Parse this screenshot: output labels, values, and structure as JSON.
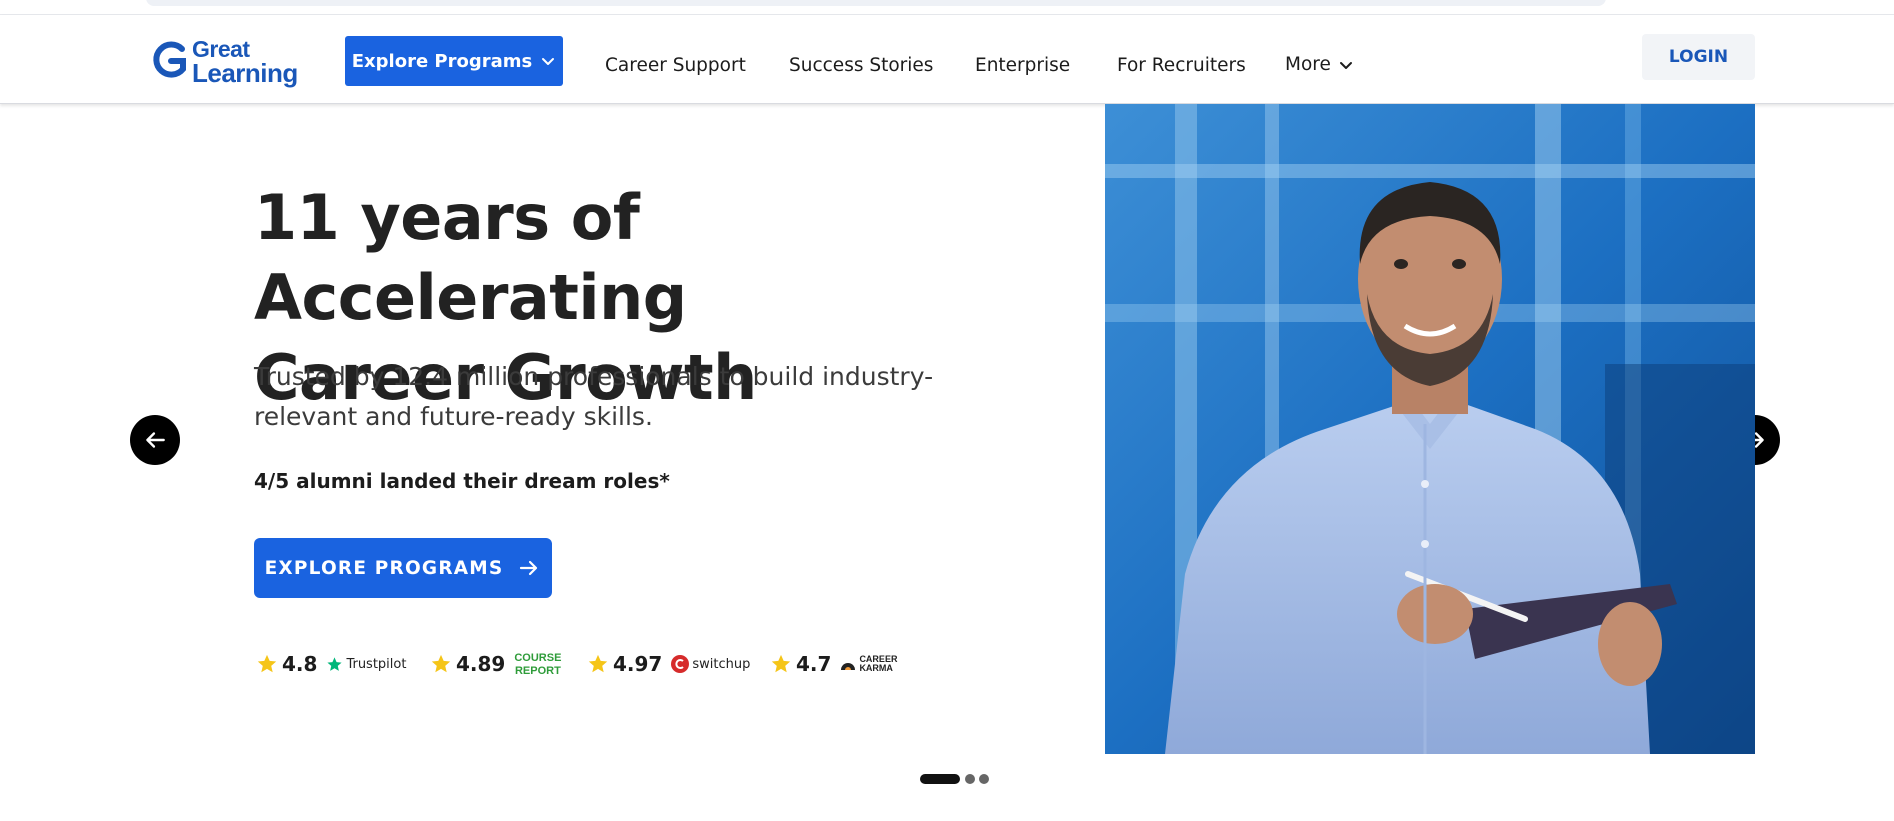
{
  "header": {
    "logo_line1": "Great",
    "logo_line2": "Learning",
    "explore_programs": "Explore Programs",
    "nav": {
      "career_support": "Career Support",
      "success_stories": "Success Stories",
      "enterprise": "Enterprise",
      "for_recruiters": "For Recruiters",
      "more": "More"
    },
    "login": "LOGIN"
  },
  "hero": {
    "title_line1": "11 years of Accelerating",
    "title_line2": "Career Growth",
    "subtitle_line1": "Trusted by 12.4 million professionals to build industry-",
    "subtitle_line2": "relevant and future-ready skills.",
    "stat": "4/5 alumni landed their dream roles*",
    "cta": "EXPLORE PROGRAMS"
  },
  "ratings": [
    {
      "score": "4.8",
      "brand": "Trustpilot"
    },
    {
      "score": "4.89",
      "brand_line1": "COURSE",
      "brand_line2": "REPORT"
    },
    {
      "score": "4.97",
      "brand": "switchup"
    },
    {
      "score": "4.7",
      "brand_line1": "CAREER",
      "brand_line2": "KARMA"
    }
  ],
  "carousel": {
    "slide_count": 3,
    "active_index": 0
  },
  "colors": {
    "primary_blue": "#1a63e0",
    "logo_blue": "#1a57b8",
    "star_yellow": "#f5c518",
    "trustpilot_green": "#00b67a",
    "course_report_green": "#2f9c3a",
    "switchup_red": "#d62b2b"
  },
  "icons": {
    "dropdown": "chevron-down-icon",
    "cta_arrow": "arrow-right-icon",
    "prev": "arrow-left-icon",
    "next": "arrow-right-icon",
    "rating": "star-icon"
  }
}
